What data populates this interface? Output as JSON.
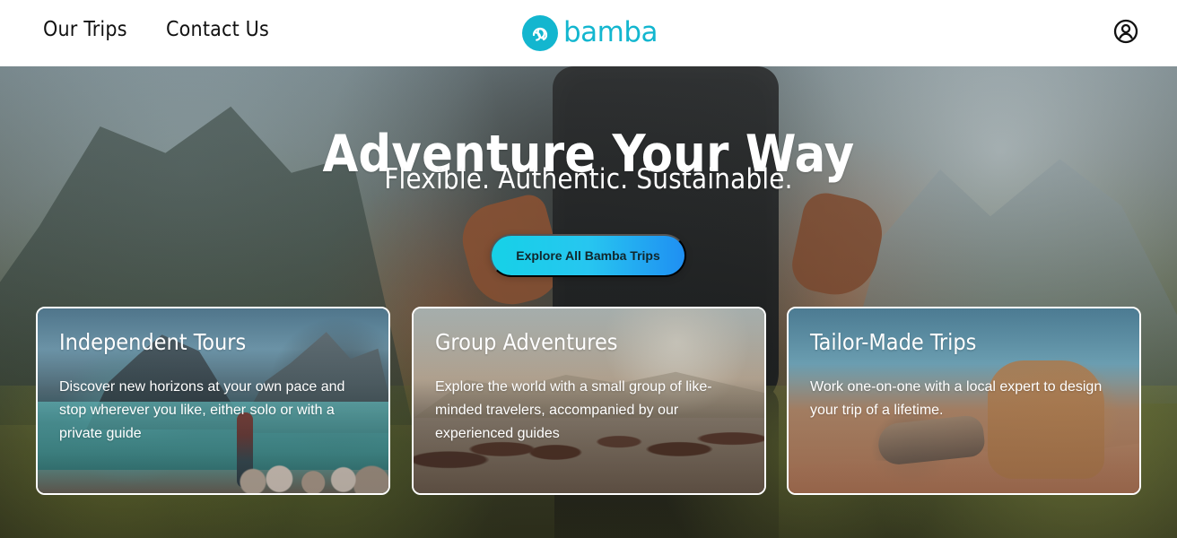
{
  "header": {
    "nav": [
      {
        "label": "Our Trips"
      },
      {
        "label": "Contact Us"
      }
    ],
    "logo": {
      "text": "bamba",
      "icon": "logo-mark-icon",
      "color": "#13b6cf"
    },
    "user_icon": "user-circle-icon"
  },
  "hero": {
    "title": "Adventure Your Way",
    "subtitle": "Flexible. Authentic. Sustainable.",
    "cta_label": "Explore All Bamba Trips",
    "cta_colors": [
      "#16d1e7",
      "#27c6f0",
      "#1f8ff2"
    ]
  },
  "cards": [
    {
      "title": "Independent Tours",
      "text": "Discover new horizons at your own pace and stop wherever you like, either solo or with a private guide"
    },
    {
      "title": "Group Adventures",
      "text": "Explore the world with a small group of like-minded travelers, accompanied by our experienced guides"
    },
    {
      "title": "Tailor-Made Trips",
      "text": "Work one-on-one with a local expert to design your trip of a lifetime."
    }
  ]
}
